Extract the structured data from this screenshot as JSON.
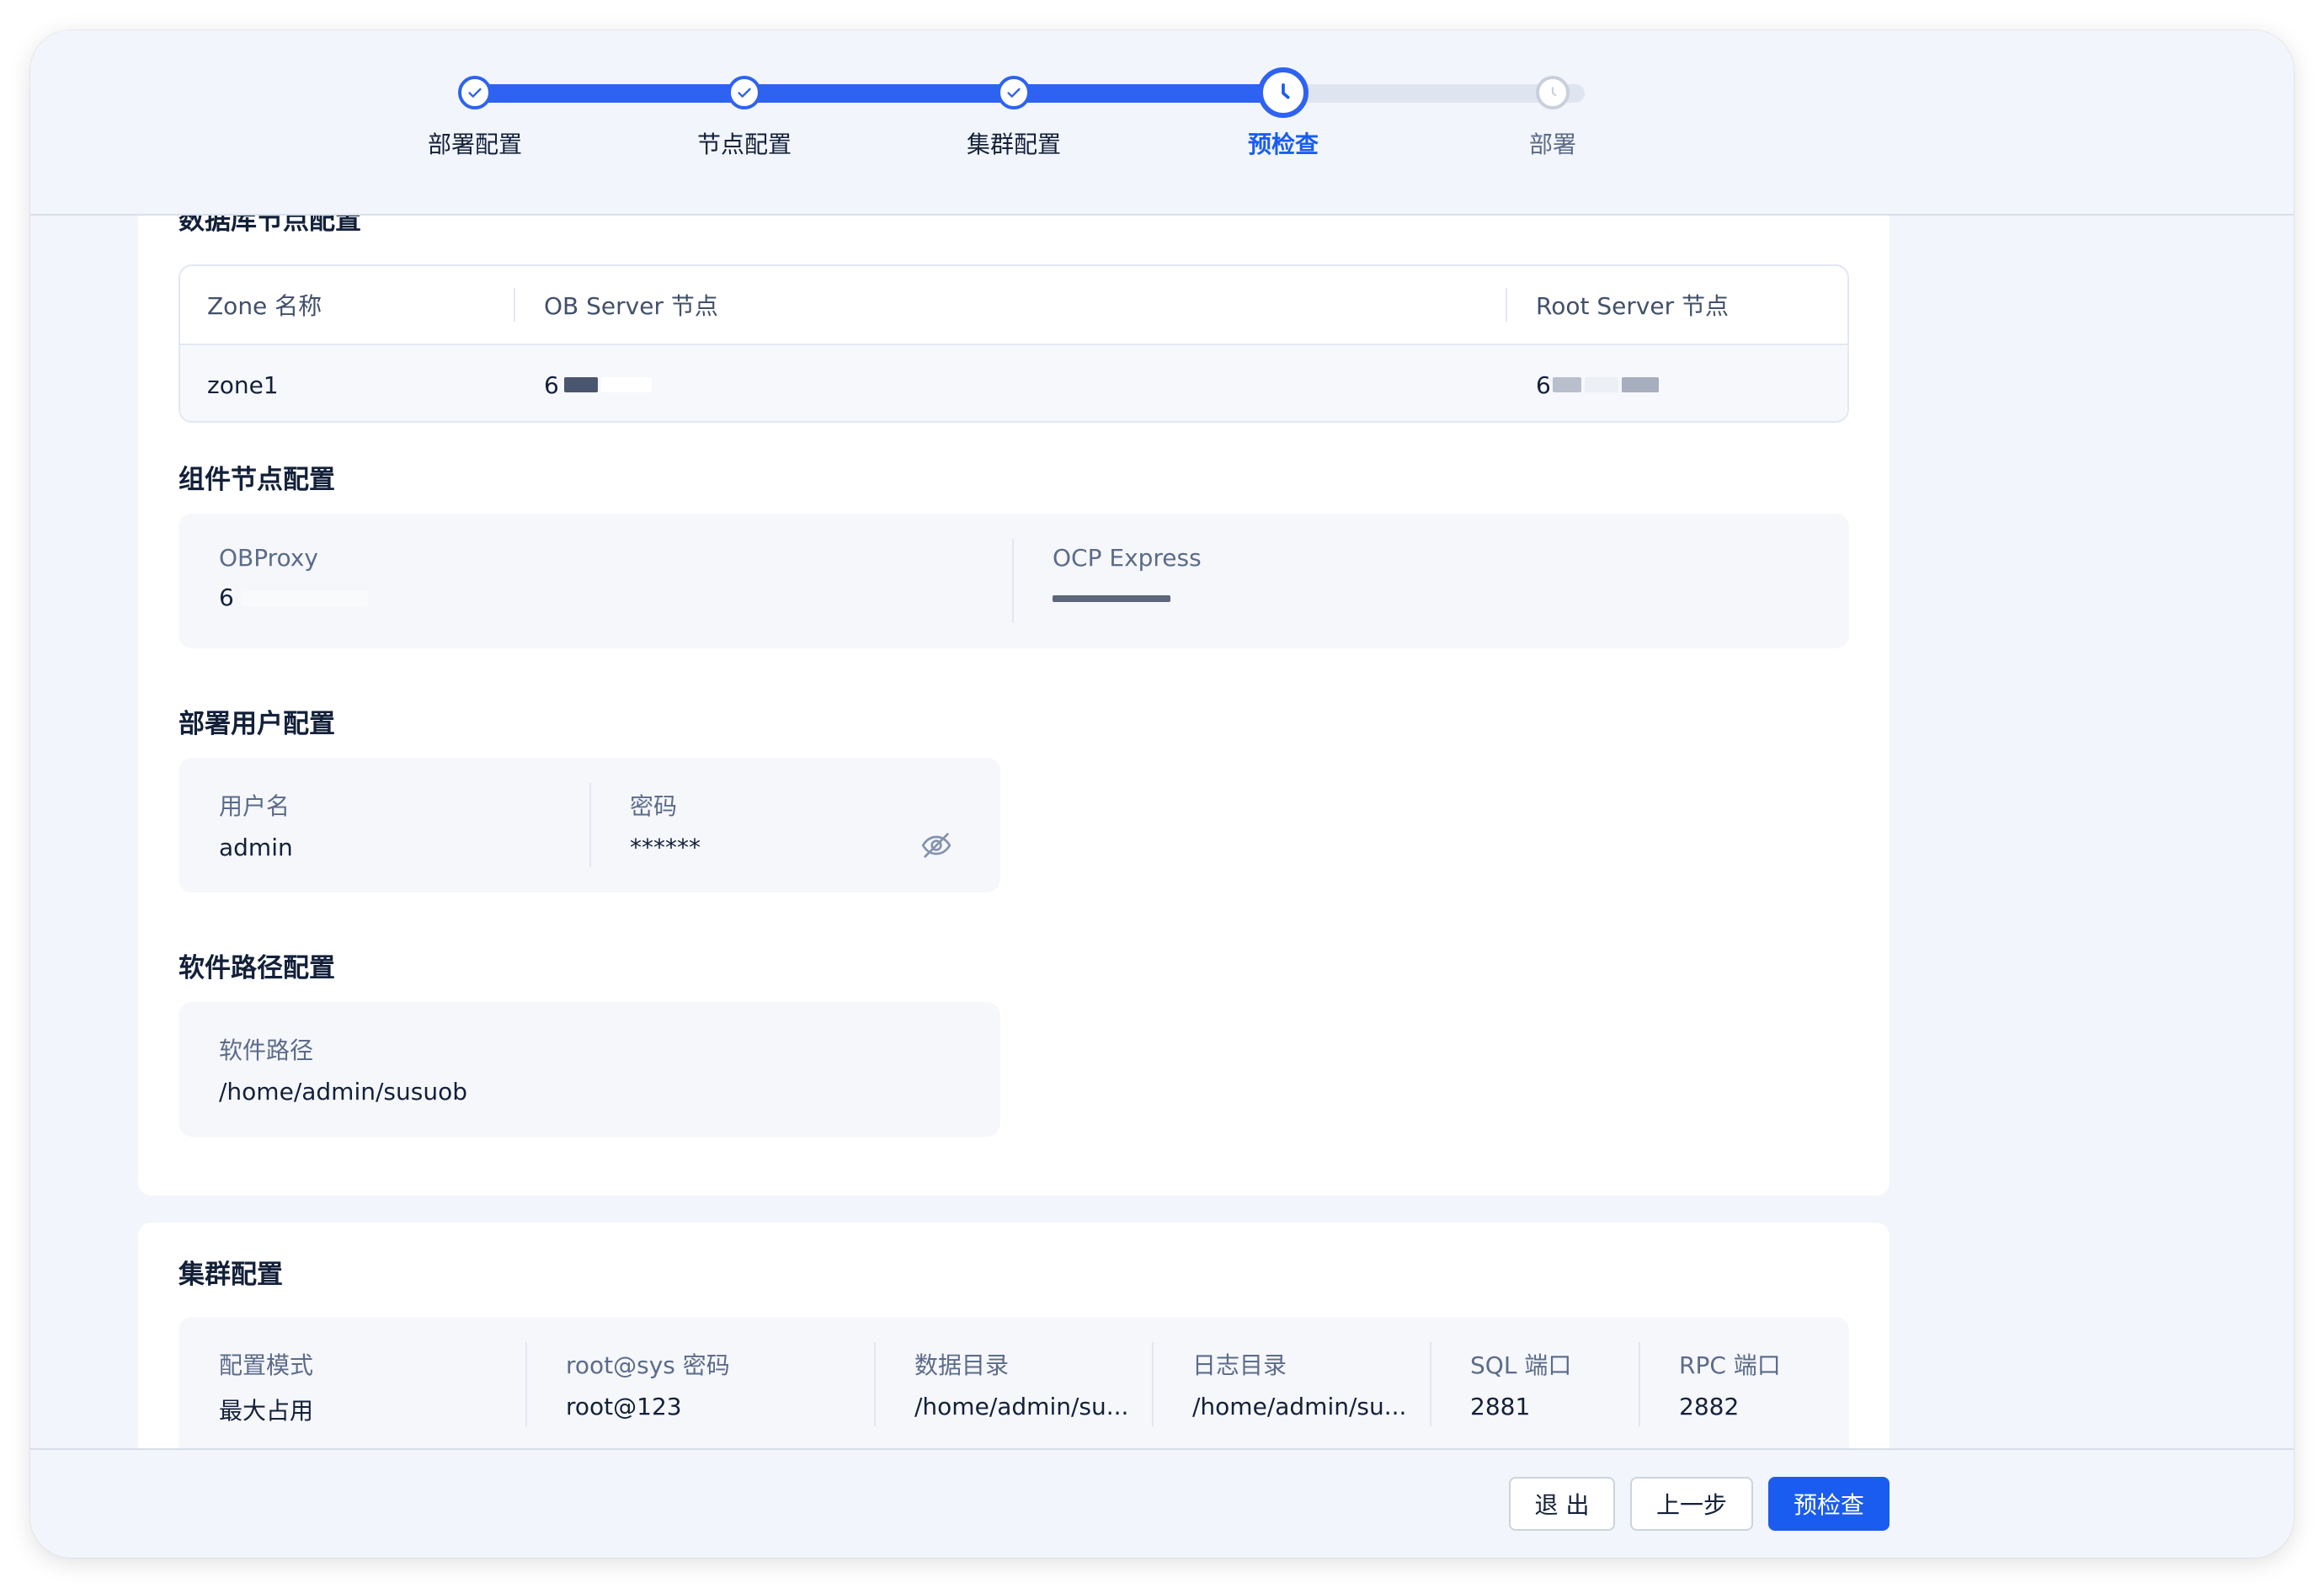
{
  "stepper": {
    "steps": [
      {
        "label": "部署配置",
        "state": "done"
      },
      {
        "label": "节点配置",
        "state": "done"
      },
      {
        "label": "集群配置",
        "state": "done"
      },
      {
        "label": "预检查",
        "state": "active"
      },
      {
        "label": "部署",
        "state": "pending"
      }
    ]
  },
  "db_nodes": {
    "title": "数据库节点配置",
    "columns": [
      "Zone 名称",
      "OB Server 节点",
      "Root Server 节点"
    ],
    "rows": [
      {
        "zone": "zone1",
        "ob_server": "6",
        "root_server": "6"
      }
    ]
  },
  "components": {
    "title": "组件节点配置",
    "obproxy": {
      "label": "OBProxy",
      "value": "6"
    },
    "ocp_express": {
      "label": "OCP Express",
      "value": ""
    }
  },
  "deploy_user": {
    "title": "部署用户配置",
    "username_label": "用户名",
    "username": "admin",
    "password_label": "密码",
    "password": "******",
    "eye_icon": "eye-slash-icon"
  },
  "software_path": {
    "title": "软件路径配置",
    "label": "软件路径",
    "value": "/home/admin/susuob"
  },
  "cluster": {
    "title": "集群配置",
    "fields": [
      {
        "label": "配置模式",
        "value": "最大占用"
      },
      {
        "label": "root@sys 密码",
        "value": "root@123"
      },
      {
        "label": "数据目录",
        "value": "/home/admin/su..."
      },
      {
        "label": "日志目录",
        "value": "/home/admin/su..."
      },
      {
        "label": "SQL 端口",
        "value": "2881"
      },
      {
        "label": "RPC 端口",
        "value": "2882"
      }
    ]
  },
  "footer": {
    "exit_label": "退 出",
    "prev_label": "上一步",
    "precheck_label": "预检查"
  },
  "colors": {
    "accent": "#1a5cf0",
    "track_done": "#2d63f0",
    "track_pending": "#dfe5f0"
  }
}
